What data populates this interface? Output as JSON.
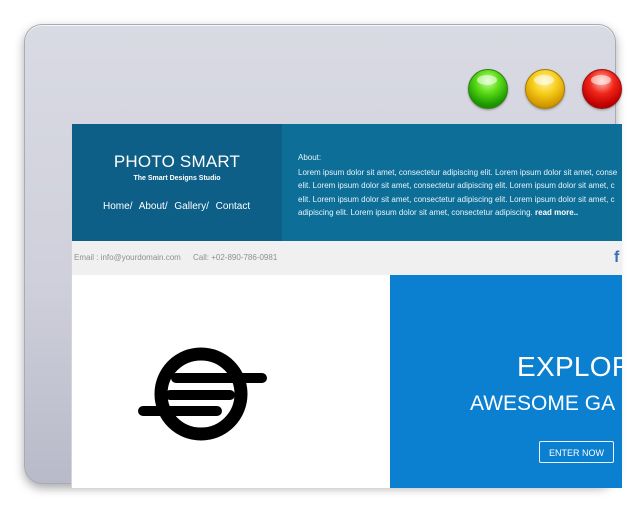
{
  "window": {
    "controls": {
      "green": "#5ddc18",
      "yellow": "#f7cd1b",
      "red": "#f0261a"
    }
  },
  "header": {
    "brand": {
      "title": "PHOTO SMART",
      "subtitle": "The Smart Designs Studio"
    },
    "nav": {
      "items": [
        "Home",
        "About",
        "Gallery",
        "Contact"
      ],
      "separator": "/"
    },
    "about": {
      "title": "About:",
      "lines": [
        "Lorem ipsum dolor sit amet, consectetur adipiscing elit. Lorem ipsum dolor sit amet, conse",
        "elit. Lorem ipsum dolor sit amet, consectetur adipiscing elit. Lorem ipsum dolor sit amet, c",
        "elit. Lorem ipsum dolor sit amet, consectetur adipiscing elit. Lorem ipsum dolor sit amet, c",
        "adipiscing elit. Lorem ipsum dolor sit amet, consectetur adipiscing."
      ],
      "read_more": "read more.."
    }
  },
  "contact": {
    "email": "Email : info@yourdomain.com",
    "call": "Call: +02-890-786-0981",
    "social_icon": "facebook-icon",
    "social_glyph": "f"
  },
  "hero": {
    "heading": "EXPLOR",
    "subheading": "AWESOME GA",
    "button_label": "ENTER NOW",
    "logo_icon": "logo-icon"
  },
  "colors": {
    "header_primary": "#0d5f87",
    "header_secondary": "#0d6e97",
    "hero_blue": "#0b7fd0",
    "contact_bar": "#f0f0f0"
  }
}
